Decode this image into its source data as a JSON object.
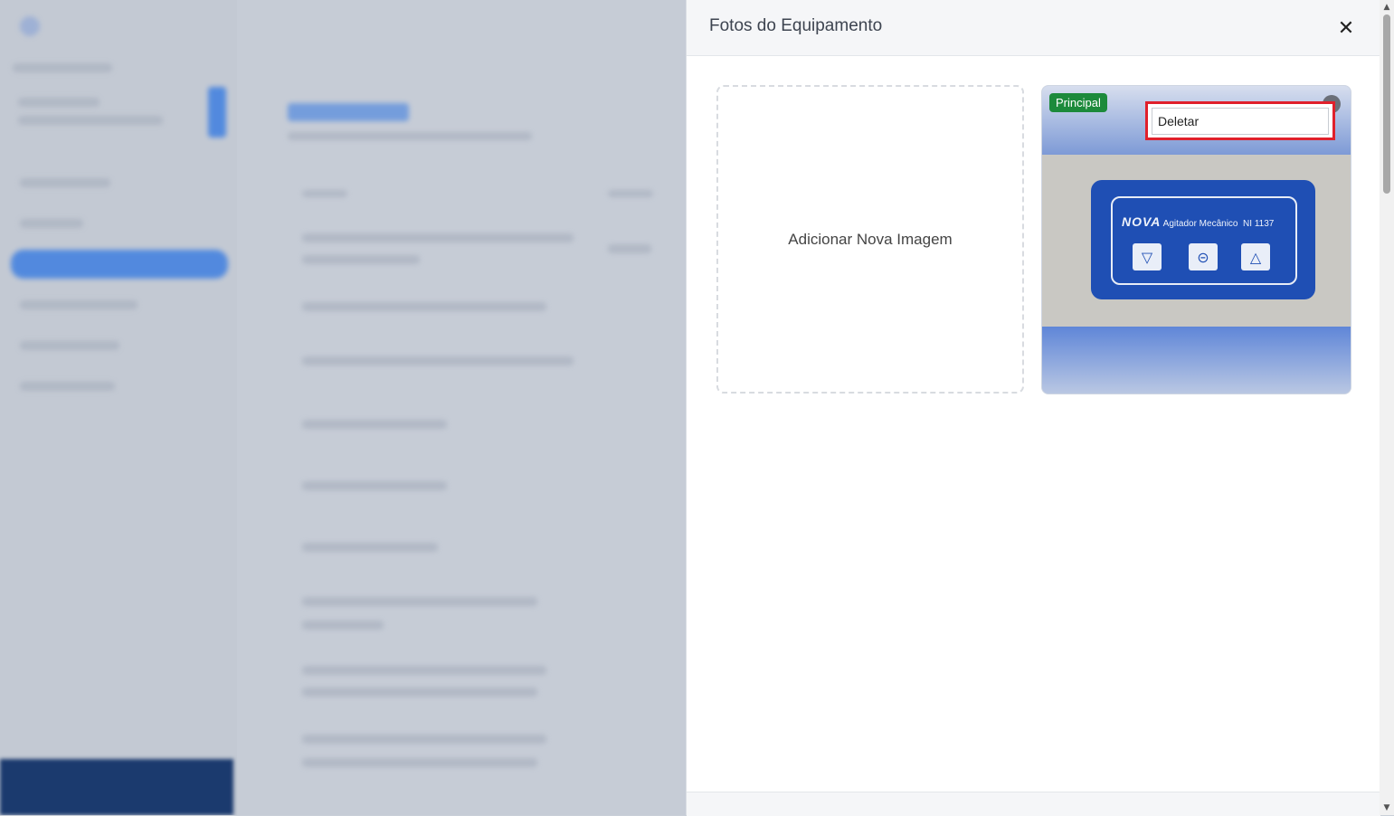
{
  "panel": {
    "title": "Fotos do Equipamento",
    "close_icon": "close-icon"
  },
  "add_image": {
    "label": "Adicionar Nova Imagem"
  },
  "photo": {
    "badge": "Principal",
    "device_brand": "NOVA",
    "device_text": "Agitador Mecânico",
    "device_code": "NI 1137",
    "menu_item": "Deletar"
  },
  "colors": {
    "badge": "#1c8a3b",
    "highlight": "#e0202b",
    "device": "#1f4fb4"
  }
}
